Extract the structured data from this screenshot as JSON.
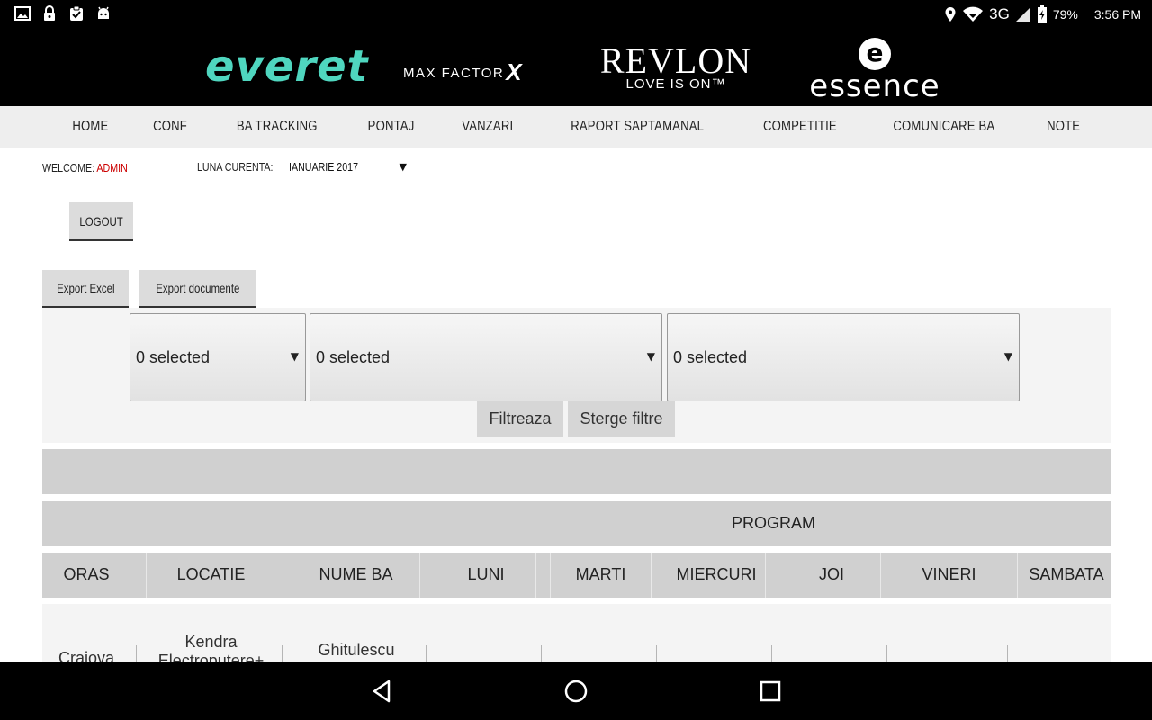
{
  "status_bar": {
    "icons_left": [
      "image-icon",
      "lock-icon",
      "clipboard-icon",
      "android-icon"
    ],
    "network": "3G",
    "battery": "79%",
    "time": "3:56 PM"
  },
  "brands": {
    "everet": "everet",
    "max_factor": "MAX FACTOR",
    "max_factor_x": "X",
    "revlon": "REVLON",
    "revlon_tagline": "LOVE IS ON™",
    "essence_mark": "e",
    "essence": "essence",
    "everet_color": "#4fd6bf"
  },
  "nav": {
    "items": [
      "HOME",
      "CONF",
      "BA TRACKING",
      "PONTAJ",
      "VANZARI",
      "RAPORT SAPTAMANAL",
      "COMPETITIE",
      "COMUNICARE BA",
      "NOTE"
    ]
  },
  "header": {
    "welcome_label": "WELCOME:",
    "user": "ADMIN",
    "user_color": "#cc0000",
    "month_label": "LUNA CURENTA:",
    "month_value": "IANUARIE 2017",
    "logout_label": "LOGOUT"
  },
  "toolbar": {
    "export_excel": "Export Excel",
    "export_documents": "Export documente"
  },
  "filters": {
    "selects": [
      "0 selected",
      "0 selected",
      "0 selected"
    ],
    "apply_label": "Filtreaza",
    "clear_label": "Sterge filtre"
  },
  "table": {
    "group_label": "PROGRAM",
    "columns": [
      "ORAS",
      "LOCATIE",
      "NUME BA",
      "LUNI",
      "MARTI",
      "MIERCURI",
      "JOI",
      "VINERI",
      "SAMBATA"
    ],
    "rows": [
      {
        "oras": "Craiova",
        "locatie": "Kendra Electroputere+",
        "nume_ba": "Ghitulescu Cristina"
      }
    ]
  }
}
